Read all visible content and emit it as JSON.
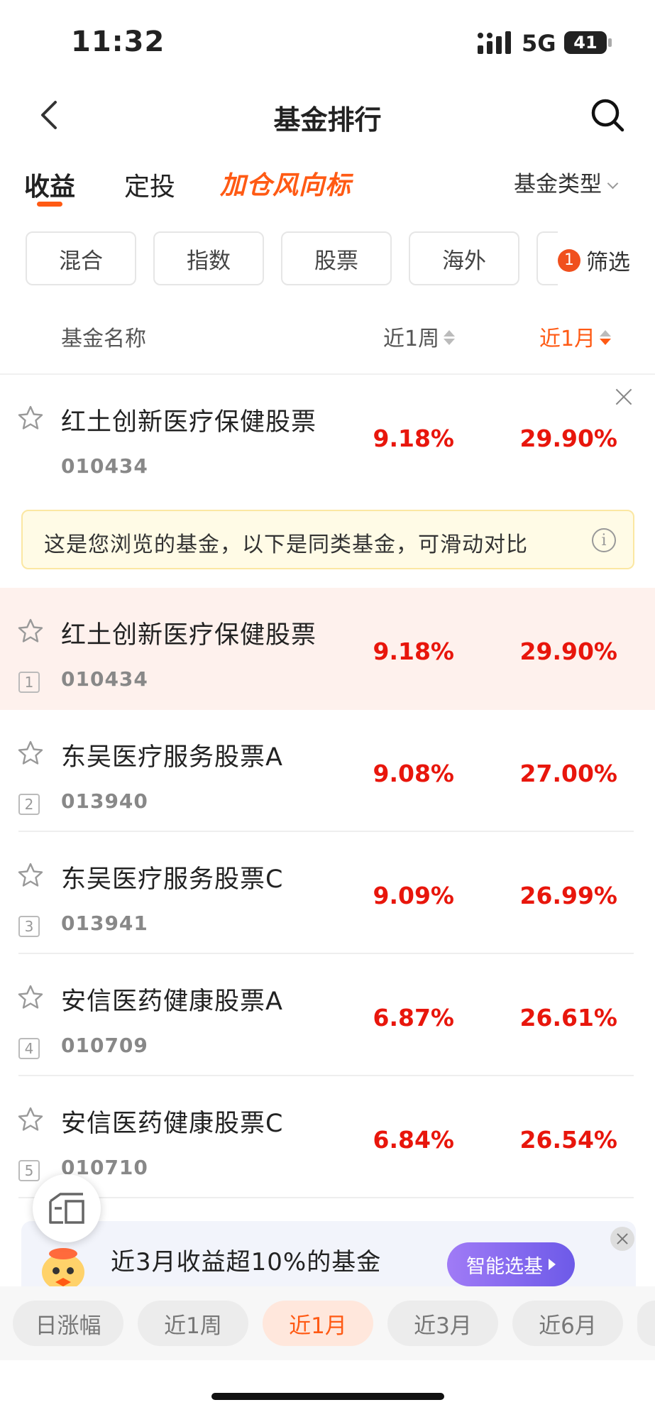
{
  "status": {
    "time": "11:32",
    "network": "5G",
    "battery": "41"
  },
  "nav": {
    "title": "基金排行"
  },
  "tabs": {
    "items": [
      "收益",
      "定投"
    ],
    "feature": "加仓风向标",
    "type_filter": "基金类型"
  },
  "chips": [
    "混合",
    "指数",
    "股票",
    "海外"
  ],
  "filter": {
    "badge": "1",
    "label": "筛选"
  },
  "table_header": {
    "name": "基金名称",
    "col1": "近1周",
    "col2": "近1月"
  },
  "viewed": {
    "name": "红土创新医疗保健股票",
    "code": "010434",
    "week": "9.18%",
    "month": "29.90%",
    "notice": "这是您浏览的基金，以下是同类基金，可滑动对比"
  },
  "rows": [
    {
      "rank": "1",
      "name": "红土创新医疗保健股票",
      "code": "010434",
      "week": "9.18%",
      "month": "29.90%"
    },
    {
      "rank": "2",
      "name": "东吴医疗服务股票A",
      "code": "013940",
      "week": "9.08%",
      "month": "27.00%"
    },
    {
      "rank": "3",
      "name": "东吴医疗服务股票C",
      "code": "013941",
      "week": "9.09%",
      "month": "26.99%"
    },
    {
      "rank": "4",
      "name": "安信医药健康股票A",
      "code": "010709",
      "week": "6.87%",
      "month": "26.61%"
    },
    {
      "rank": "5",
      "name": "安信医药健康股票C",
      "code": "010710",
      "week": "6.84%",
      "month": "26.54%"
    }
  ],
  "promo": {
    "text": "近3月收益超10%的基金",
    "button": "智能选基"
  },
  "periods": [
    "日涨幅",
    "近1周",
    "近1月",
    "近3月",
    "近6月"
  ],
  "colors": {
    "accent": "#ff5a14",
    "gain": "#e8160c",
    "highlight_row": "#fef1ed",
    "notice_bg": "#fffbe6"
  }
}
